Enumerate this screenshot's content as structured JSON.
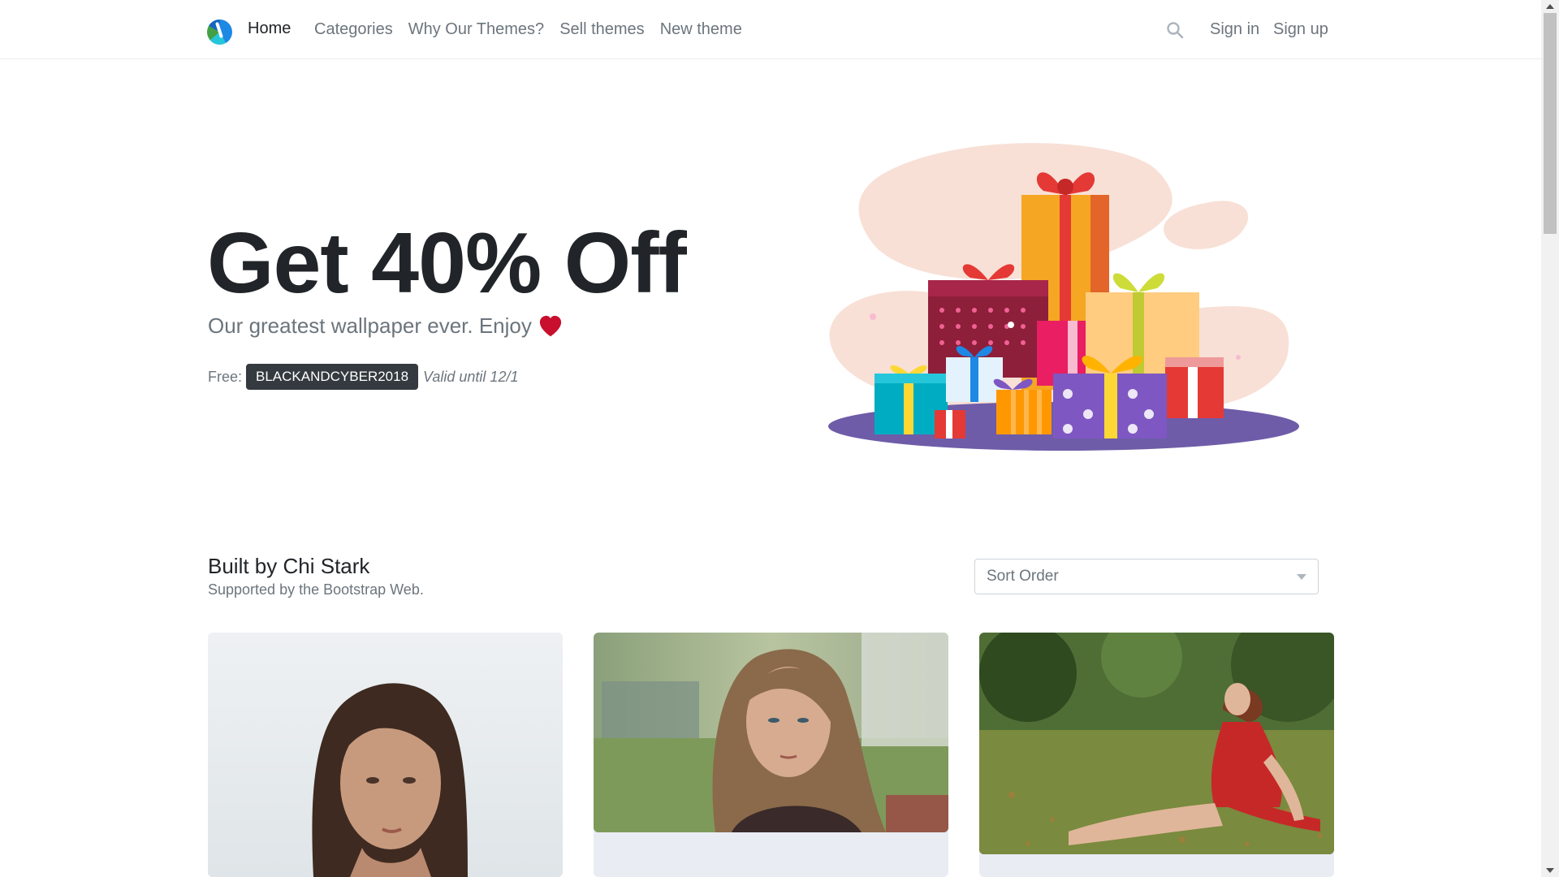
{
  "nav": {
    "home": "Home",
    "links": [
      "Categories",
      "Why Our Themes?",
      "Sell themes",
      "New theme"
    ],
    "sign_in": "Sign in",
    "sign_up": "Sign up",
    "search_icon": "search-icon",
    "logo_icon": "brand-logo-icon"
  },
  "hero": {
    "title": "Get 40% Off",
    "subtitle": "Our greatest wallpaper ever. Enjoy",
    "heart_icon": "heart-icon",
    "heart_color": "#c8102e",
    "promo_label": "Free:",
    "promo_code": "BLACKANDCYBER2018",
    "promo_valid": "Valid until 12/1",
    "illustration": "gift-boxes-illustration"
  },
  "section": {
    "title": "Built by Chi Stark",
    "subtitle": "Supported by the Bootstrap Web.",
    "sort_placeholder": "Sort Order"
  },
  "cards": [
    {
      "image": "portrait-wet-hair-photo"
    },
    {
      "image": "portrait-outdoor-hair-photo"
    },
    {
      "image": "woman-red-dress-park-photo"
    }
  ],
  "colors": {
    "accent_dark": "#343a40",
    "muted": "#6c757d",
    "text": "#212529",
    "illustration_plate": "#6e5ca8"
  }
}
